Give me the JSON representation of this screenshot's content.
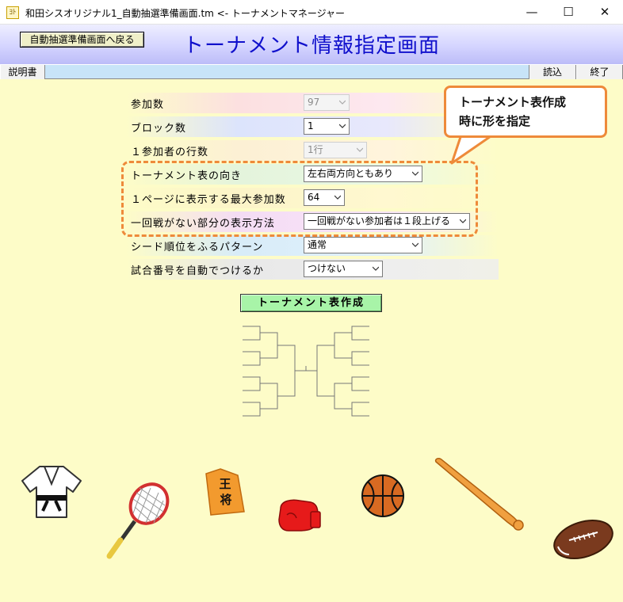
{
  "window": {
    "title": "和田シスオリジナル1_自動抽選準備画面.tm <- トーナメントマネージャー",
    "icon_text": "ﾖﾄ",
    "min_glyph": "—",
    "max_glyph": "☐",
    "close_glyph": "✕"
  },
  "header": {
    "back_label": "自動抽選準備画面へ戻る",
    "title": "トーナメント情報指定画面"
  },
  "menubar": {
    "manual_label": "説明書",
    "read_label": "読込",
    "exit_label": "終了"
  },
  "form": {
    "rows": [
      {
        "label": "参加数",
        "value": "97",
        "disabled": true
      },
      {
        "label": "ブロック数",
        "value": "1",
        "disabled": false
      },
      {
        "label": "１参加者の行数",
        "value": "1行",
        "disabled": true
      },
      {
        "label": "トーナメント表の向き",
        "value": "左右両方向ともあり",
        "disabled": false
      },
      {
        "label": "１ページに表示する最大参加数",
        "value": "64",
        "disabled": false
      },
      {
        "label": "一回戦がない部分の表示方法",
        "value": "一回戦がない参加者は１段上げる",
        "disabled": false
      },
      {
        "label": "シード順位をふるパターン",
        "value": "通常",
        "disabled": false
      },
      {
        "label": "試合番号を自動でつけるか",
        "value": "つけない",
        "disabled": false
      }
    ],
    "create_label": "トーナメント表作成"
  },
  "callout": {
    "line1": "トーナメント表作成",
    "line2": "時に形を指定"
  },
  "colors": {
    "accent_orange": "#ee8a3a",
    "title_blue": "#1010cc",
    "main_bg": "#fdfcc8",
    "create_green": "#a8f4a8"
  },
  "decorations": {
    "shogi_char1": "王",
    "shogi_char2": "将"
  }
}
